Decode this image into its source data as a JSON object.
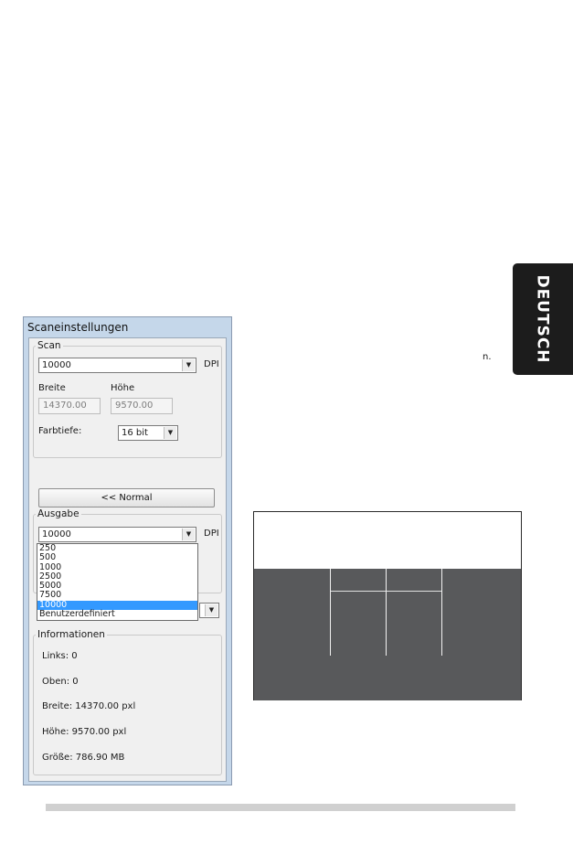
{
  "side_tab": {
    "label": "DEUTSCH"
  },
  "stray_text": "n.",
  "window": {
    "title": "Scaneinstellungen",
    "scan": {
      "legend": "Scan",
      "dpi_value": "10000",
      "dpi_unit": "DPI",
      "width_label": "Breite",
      "height_label": "Höhe",
      "width_value": "14370.00",
      "height_value": "9570.00",
      "color_depth_label": "Farbtiefe:",
      "color_depth_value": "16 bit"
    },
    "normal_button": "<< Normal",
    "output": {
      "legend": "Ausgabe",
      "dpi_value": "10000",
      "dpi_unit": "DPI",
      "dropdown_options": [
        "250",
        "500",
        "1000",
        "2500",
        "5000",
        "7500",
        "10000",
        "Benutzerdefiniert"
      ],
      "selected_index": 6
    },
    "info": {
      "legend": "Informationen",
      "left": "Links: 0",
      "top": "Oben: 0",
      "width": "Breite: 14370.00 pxl",
      "height": "Höhe: 9570.00 pxl",
      "size": "Größe: 786.90 MB"
    }
  },
  "colors": {
    "selection": "#3399ff",
    "side_tab_bg": "#1c1c1c",
    "graphic_dark": "#58595b",
    "window_frame": "#c5d7ea"
  }
}
